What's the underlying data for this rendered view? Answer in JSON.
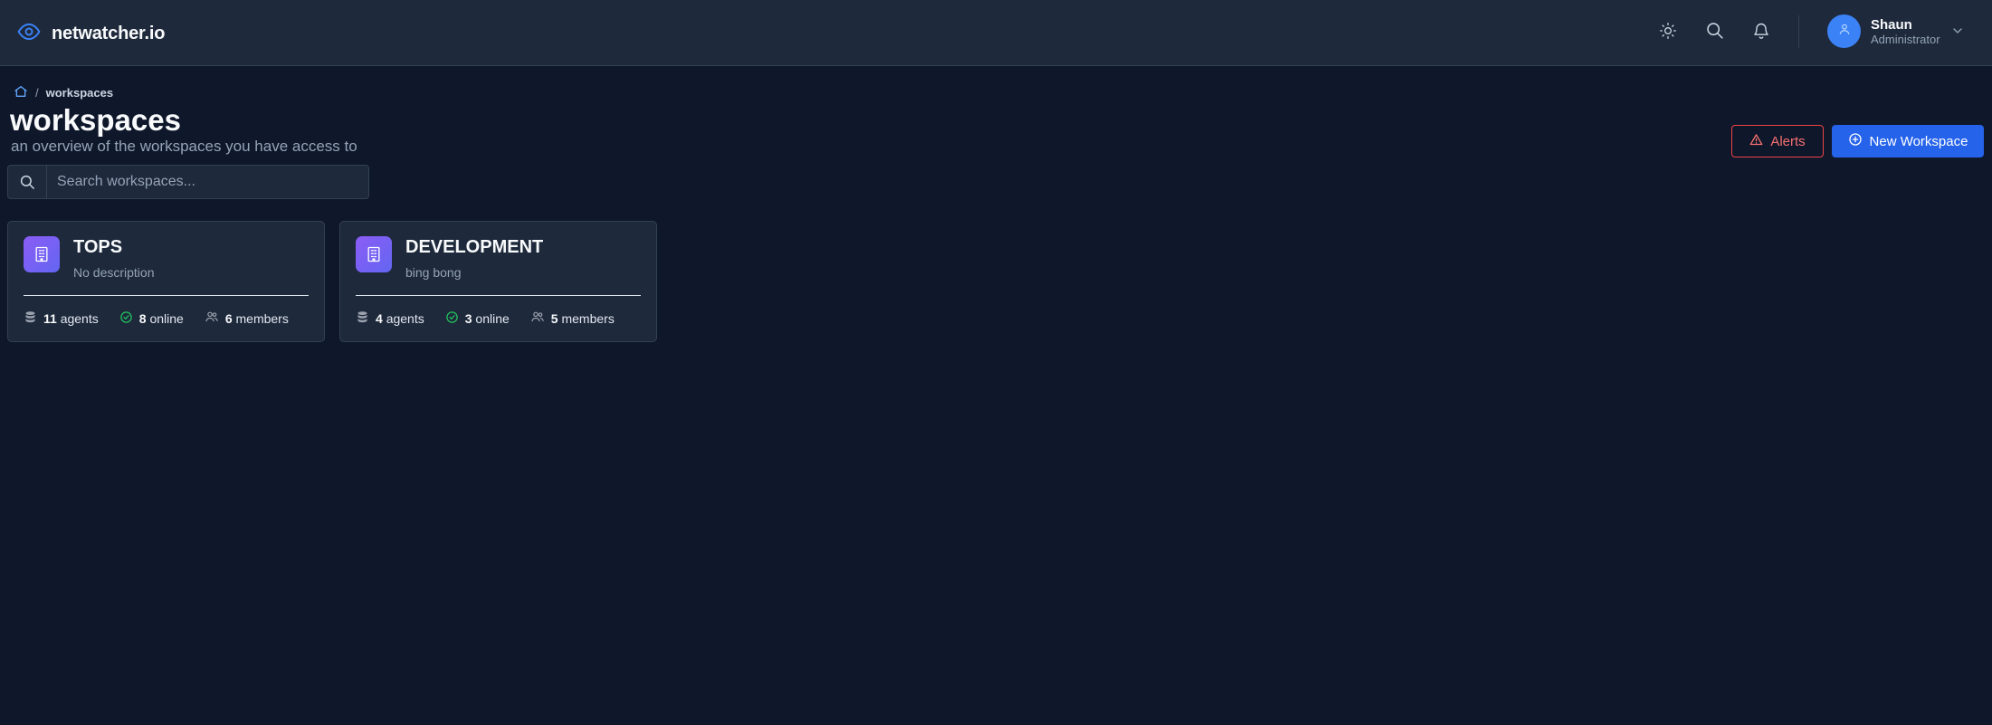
{
  "header": {
    "brand": "netwatcher.io",
    "user": {
      "name": "Shaun",
      "role": "Administrator"
    },
    "icons": [
      "eye-icon",
      "sun-icon",
      "search-icon",
      "bell-icon",
      "user-icon",
      "chevron-down-icon"
    ]
  },
  "breadcrumb": {
    "home_icon": "home-icon",
    "separator": "/",
    "current": "workspaces"
  },
  "page": {
    "title": "workspaces",
    "subtitle": "an overview of the workspaces you have access to"
  },
  "actions": {
    "alerts_label": "Alerts",
    "new_workspace_label": "New Workspace"
  },
  "search": {
    "placeholder": "Search workspaces...",
    "value": ""
  },
  "workspaces": [
    {
      "name": "TOPS",
      "description": "No description",
      "agents": "11",
      "agents_label": "agents",
      "online": "8",
      "online_label": "online",
      "members": "6",
      "members_label": "members"
    },
    {
      "name": "DEVELOPMENT",
      "description": "bing bong",
      "agents": "4",
      "agents_label": "agents",
      "online": "3",
      "online_label": "online",
      "members": "5",
      "members_label": "members"
    }
  ],
  "colors": {
    "background": "#0f172a",
    "surface": "#1e293b",
    "accent": "#2563eb",
    "danger": "#ef4444",
    "success": "#22c55e",
    "workspace_icon": "#7c5cf0"
  }
}
